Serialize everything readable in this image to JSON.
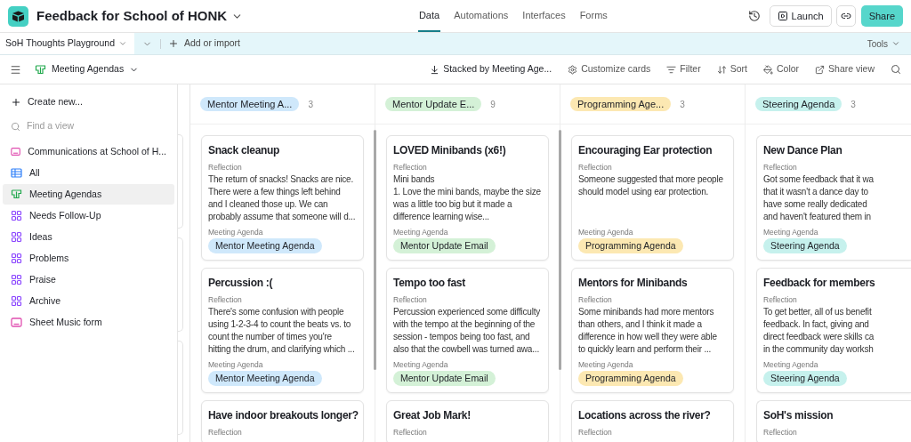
{
  "app": {
    "title": "Feedback for School of HONK"
  },
  "nav_tabs": [
    {
      "label": "Data",
      "selected": true
    },
    {
      "label": "Automations",
      "selected": false
    },
    {
      "label": "Interfaces",
      "selected": false
    },
    {
      "label": "Forms",
      "selected": false
    }
  ],
  "actions": {
    "launch": "Launch",
    "share": "Share"
  },
  "table_tab": {
    "label": "SoH Thoughts Playground",
    "add": "Add or import",
    "tools": "Tools"
  },
  "view_bar": {
    "view": "Meeting Agendas",
    "stacked": "Stacked by Meeting Age...",
    "customize": "Customize cards",
    "filter": "Filter",
    "sort": "Sort",
    "color_label": "Color",
    "share_view": "Share view"
  },
  "sidebar": {
    "create": "Create new...",
    "search_placeholder": "Find a view",
    "items": [
      {
        "label": "Communications at School of H...",
        "kind": "form",
        "selected": false
      },
      {
        "label": "All",
        "kind": "grid",
        "selected": false
      },
      {
        "label": "Meeting Agendas",
        "kind": "kanban",
        "selected": true
      },
      {
        "label": "Needs Follow-Up",
        "kind": "gallery",
        "selected": false
      },
      {
        "label": "Ideas",
        "kind": "gallery",
        "selected": false
      },
      {
        "label": "Problems",
        "kind": "gallery",
        "selected": false
      },
      {
        "label": "Praise",
        "kind": "gallery",
        "selected": false
      },
      {
        "label": "Archive",
        "kind": "gallery",
        "selected": false
      },
      {
        "label": "Sheet Music form",
        "kind": "form",
        "selected": false
      }
    ]
  },
  "columns": [
    {
      "name": "Mentor Meeting A...",
      "count": "3",
      "color": "#cfe8fb",
      "cards": [
        {
          "title": "Snack cleanup",
          "field_1": "Reflection",
          "body": "The return of snacks! Snacks are nice.\nThere were a few things left behind\nand I cleaned those up. We can\nprobably assume that someone will d...",
          "field_2": "Meeting Agenda",
          "tag": "Mentor Meeting Agenda"
        },
        {
          "title": "Percussion :(",
          "field_1": "Reflection",
          "body": "There's some confusion with people\nusing 1-2-3-4 to count the beats vs. to\ncount the number of times you're\nhitting the drum, and clarifying which ...",
          "field_2": "Meeting Agenda",
          "tag": "Mentor Meeting Agenda"
        },
        {
          "title": "Have indoor breakouts longer?",
          "field_1": "Reflection"
        }
      ]
    },
    {
      "name": "Mentor Update E...",
      "count": "9",
      "color": "#d4f1d7",
      "cards": [
        {
          "title": "LOVED Minibands (x6!)",
          "field_1": "Reflection",
          "body": "Mini bands\n1. Love the mini bands, maybe the size\nwas a little too big but it made a\ndifference learning wise...",
          "field_2": "Meeting Agenda",
          "tag": "Mentor Update Email"
        },
        {
          "title": "Tempo too fast",
          "field_1": "Reflection",
          "body": "Percussion experienced some difficulty\nwith the tempo at the beginning of the\nsession - tempos being too fast, and\nalso that the cowbell was turned awa...",
          "field_2": "Meeting Agenda",
          "tag": "Mentor Update Email"
        },
        {
          "title": "Great Job Mark!",
          "field_1": "Reflection"
        }
      ]
    },
    {
      "name": "Programming Age...",
      "count": "3",
      "color": "#fce8b2",
      "cards": [
        {
          "title": "Encouraging Ear protection",
          "field_1": "Reflection",
          "body": "Someone suggested that more people\nshould model using ear protection.",
          "field_2": "Meeting Agenda",
          "tag": "Programming Agenda"
        },
        {
          "title": "Mentors for Minibands",
          "field_1": "Reflection",
          "body": "Some minibands had more mentors\nthan others, and I think it made a\ndifference in how well they were able\nto quickly learn and perform their ...",
          "field_2": "Meeting Agenda",
          "tag": "Programming Agenda"
        },
        {
          "title": "Locations across the river?",
          "field_1": "Reflection"
        }
      ]
    },
    {
      "name": "Steering Agenda",
      "count": "3",
      "color": "#c6f1ed",
      "cards": [
        {
          "title": "New Dance Plan",
          "field_1": "Reflection",
          "body": "Got some feedback that it wa\nthat it wasn't a dance day to\nhave some really dedicated\nand haven't featured them in",
          "field_2": "Meeting Agenda",
          "tag": "Steering Agenda"
        },
        {
          "title": "Feedback for members",
          "field_1": "Reflection",
          "body": "To get better, all of us benefit\nfeedback. In fact, giving and\ndirect feedback were skills ca\nin the community day worksh",
          "field_2": "Meeting Agenda",
          "tag": "Steering Agenda"
        },
        {
          "title": "SoH's mission",
          "field_1": "Reflection"
        }
      ]
    }
  ]
}
